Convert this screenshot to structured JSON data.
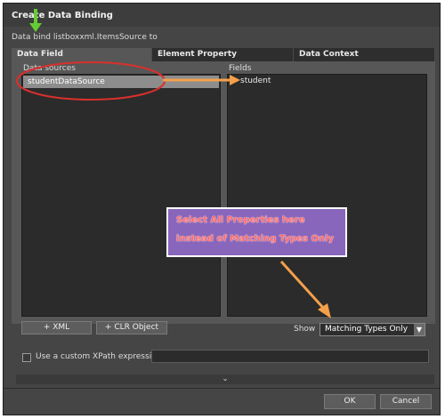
{
  "dialog": {
    "title": "Create Data Binding",
    "subtitle": "Data bind listboxxml.ItemsSource to"
  },
  "tabs": [
    {
      "label": "Data Field",
      "active": true
    },
    {
      "label": "Element Property",
      "active": false
    },
    {
      "label": "Data Context",
      "active": false
    }
  ],
  "data_sources": {
    "label": "Data sources",
    "items": [
      "studentDataSource"
    ],
    "selected": "studentDataSource"
  },
  "fields": {
    "label": "Fields",
    "items": [
      "student"
    ]
  },
  "buttons": {
    "xml": "+ XML",
    "clr_object": "+ CLR Object",
    "ok": "OK",
    "cancel": "Cancel"
  },
  "show": {
    "label": "Show",
    "selected": "Matching Types Only"
  },
  "xpath": {
    "label": "Use a custom XPath expression",
    "value": ""
  },
  "annotation": {
    "line1": "Select All Properties here",
    "line2": "instead of Matching Types Only"
  },
  "icons": {
    "expander": "chevron-down-icon",
    "dropdown": "dropdown-arrow-icon"
  },
  "colors": {
    "callout_bg": "#8866bb",
    "callout_text": "#ff6a6a",
    "arrow": "#f4a04a",
    "highlight_ring": "#d9302c",
    "pointer_arrow": "#66cc33"
  }
}
